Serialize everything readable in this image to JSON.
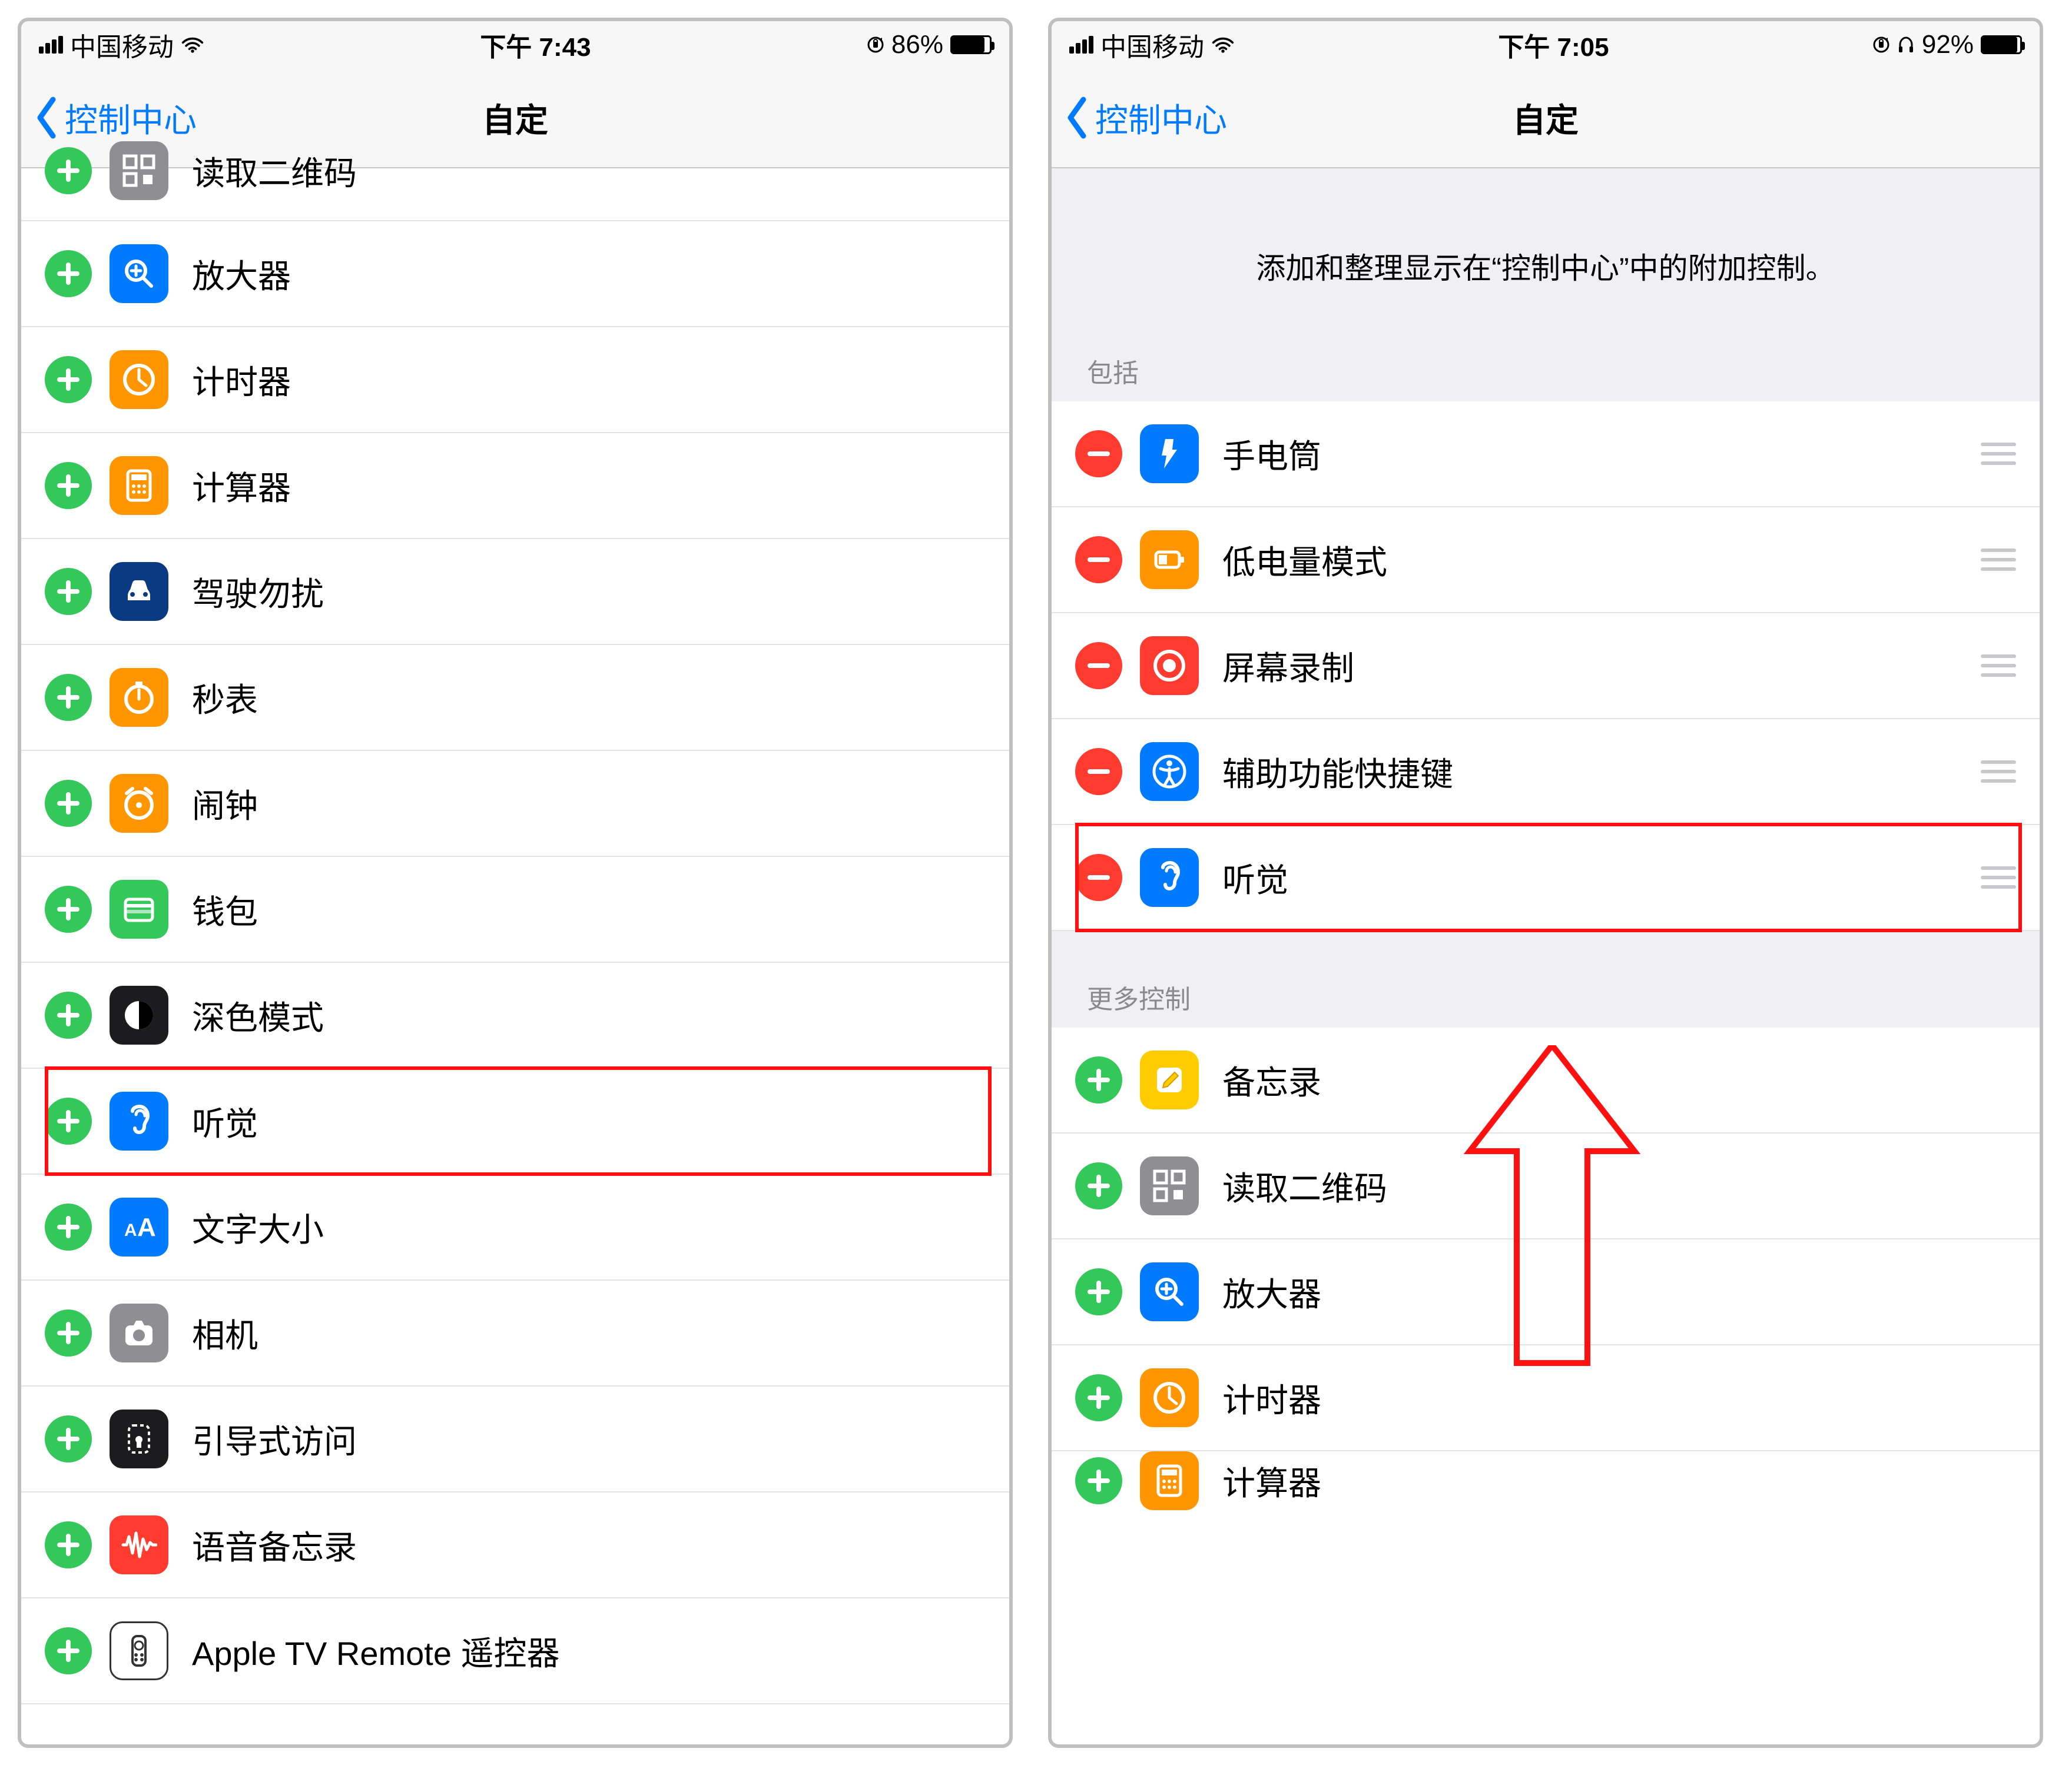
{
  "left": {
    "status": {
      "carrier": "中国移动",
      "time": "下午 7:43",
      "battery_pct": "86%",
      "battery_fill": 86,
      "headphones": false
    },
    "nav": {
      "back": "控制中心",
      "title": "自定"
    },
    "rows": [
      {
        "action": "add",
        "icon": "qr-icon",
        "bg": "bg-gray",
        "label": "读取二维码",
        "trunc": true
      },
      {
        "action": "add",
        "icon": "magnifier-icon",
        "bg": "bg-blue",
        "label": "放大器"
      },
      {
        "action": "add",
        "icon": "timer-icon",
        "bg": "bg-orange",
        "label": "计时器"
      },
      {
        "action": "add",
        "icon": "calculator-icon",
        "bg": "bg-orange",
        "label": "计算器"
      },
      {
        "action": "add",
        "icon": "car-icon",
        "bg": "bg-darkblue",
        "label": "驾驶勿扰"
      },
      {
        "action": "add",
        "icon": "stopwatch-icon",
        "bg": "bg-orange",
        "label": "秒表"
      },
      {
        "action": "add",
        "icon": "alarm-icon",
        "bg": "bg-orange",
        "label": "闹钟"
      },
      {
        "action": "add",
        "icon": "wallet-icon",
        "bg": "bg-green",
        "label": "钱包"
      },
      {
        "action": "add",
        "icon": "darkmode-icon",
        "bg": "bg-black",
        "label": "深色模式"
      },
      {
        "action": "add",
        "icon": "ear-icon",
        "bg": "bg-blue",
        "label": "听觉",
        "highlight": true
      },
      {
        "action": "add",
        "icon": "textsize-icon",
        "bg": "bg-blue",
        "label": "文字大小"
      },
      {
        "action": "add",
        "icon": "camera-icon",
        "bg": "bg-gray",
        "label": "相机"
      },
      {
        "action": "add",
        "icon": "guided-icon",
        "bg": "bg-black",
        "label": "引导式访问"
      },
      {
        "action": "add",
        "icon": "voicememo-icon",
        "bg": "bg-red",
        "label": "语音备忘录"
      },
      {
        "action": "add",
        "icon": "appletv-icon",
        "bg": "bg-white-b",
        "label": "Apple TV Remote 遥控器"
      }
    ]
  },
  "right": {
    "status": {
      "carrier": "中国移动",
      "time": "下午 7:05",
      "battery_pct": "92%",
      "battery_fill": 92,
      "headphones": true
    },
    "nav": {
      "back": "控制中心",
      "title": "自定"
    },
    "desc": "添加和整理显示在“控制中心”中的附加控制。",
    "sect_include": "包括",
    "included": [
      {
        "action": "rem",
        "icon": "flashlight-icon",
        "bg": "bg-blue",
        "label": "手电筒"
      },
      {
        "action": "rem",
        "icon": "lowpower-icon",
        "bg": "bg-orange",
        "label": "低电量模式"
      },
      {
        "action": "rem",
        "icon": "record-icon",
        "bg": "bg-red",
        "label": "屏幕录制"
      },
      {
        "action": "rem",
        "icon": "accessibility-icon",
        "bg": "bg-blue",
        "label": "辅助功能快捷键"
      },
      {
        "action": "rem",
        "icon": "ear-icon",
        "bg": "bg-blue",
        "label": "听觉",
        "highlight": true
      }
    ],
    "sect_more": "更多控制",
    "more": [
      {
        "action": "add",
        "icon": "notes-icon",
        "bg": "bg-yellow",
        "label": "备忘录"
      },
      {
        "action": "add",
        "icon": "qr-icon",
        "bg": "bg-gray",
        "label": "读取二维码"
      },
      {
        "action": "add",
        "icon": "magnifier-icon",
        "bg": "bg-blue",
        "label": "放大器"
      },
      {
        "action": "add",
        "icon": "timer-icon",
        "bg": "bg-orange",
        "label": "计时器"
      },
      {
        "action": "add",
        "icon": "calculator-icon",
        "bg": "bg-orange",
        "label": "计算器",
        "partial": true
      }
    ]
  }
}
